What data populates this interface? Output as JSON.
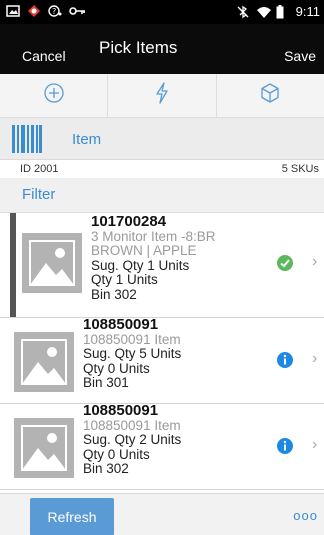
{
  "status_bar": {
    "time": "9:11",
    "icons_left": [
      "gallery-icon",
      "app-icon",
      "alert-icon",
      "key-icon"
    ],
    "icons_right": [
      "bluetooth-off-icon",
      "wifi-icon",
      "battery-icon"
    ]
  },
  "header": {
    "cancel_label": "Cancel",
    "title": "Pick Items",
    "save_label": "Save"
  },
  "toolbar": {
    "buttons": [
      "add-icon",
      "flash-icon",
      "box-icon"
    ]
  },
  "search": {
    "label": "Item"
  },
  "info": {
    "id_text": "ID 2001",
    "sku_count": "5 SKUs"
  },
  "filter_label": "Filter",
  "items": [
    {
      "code": "101700284",
      "desc1": "3 Monitor Item -8:BR",
      "desc2": "BROWN | APPLE",
      "sug_qty": "Sug. Qty  1  Units",
      "qty": "Qty  1  Units",
      "bin": "Bin  302",
      "status": "complete",
      "status_color": "#5cb85c"
    },
    {
      "code": "108850091",
      "desc1": "108850091 Item",
      "sug_qty": "Sug. Qty  5  Units",
      "qty": "Qty  0  Units",
      "bin": "Bin  301",
      "status": "info",
      "status_color": "#1e88e5"
    },
    {
      "code": "108850091",
      "desc1": "108850091 Item",
      "sug_qty": "Sug. Qty  2  Units",
      "qty": "Qty  0  Units",
      "bin": "Bin  302",
      "status": "info",
      "status_color": "#1e88e5"
    }
  ],
  "footer": {
    "refresh_label": "Refresh",
    "more_label": "ooo"
  },
  "colors": {
    "accent": "#3b8dd1",
    "header_bg": "#0b0b0b",
    "refresh_bg": "#5b9bd5"
  }
}
